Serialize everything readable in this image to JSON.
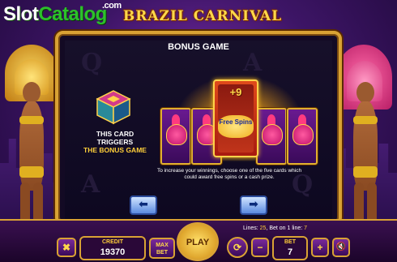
{
  "brand": {
    "part1": "Slot",
    "part2": "Catalog",
    "suffix": ".com"
  },
  "game": {
    "title": "BRAZIL CARNIVAL"
  },
  "bonus": {
    "heading": "BONUS GAME",
    "trigger_line1": "THIS CARD",
    "trigger_line2": "TRIGGERS",
    "trigger_line3": "THE BONUS GAME",
    "featured_card_value": "+9",
    "featured_card_label": "Free Spins",
    "description": "To increase your winnings, choose one of the five cards which could award free spins or a cash prize."
  },
  "nav": {
    "prev_glyph": "⬅",
    "next_glyph": "➡"
  },
  "status": {
    "lines_label": "Lines:",
    "lines_value": "25",
    "bet_on_line_label": "Bet on 1 line:",
    "bet_on_line_value": "7"
  },
  "controls": {
    "close_glyph": "✖",
    "credit_label": "CREDIT",
    "credit_value": "19370",
    "max_bet_line1": "MAX",
    "max_bet_line2": "BET",
    "play_label": "PLAY",
    "auto_glyph": "⟳",
    "minus_glyph": "−",
    "bet_label": "BET",
    "bet_value": "7",
    "plus_glyph": "+",
    "sound_glyph": "🔇"
  },
  "colors": {
    "accent_gold": "#d9a234",
    "panel_dark": "#130a24",
    "purple": "#3d1566"
  }
}
